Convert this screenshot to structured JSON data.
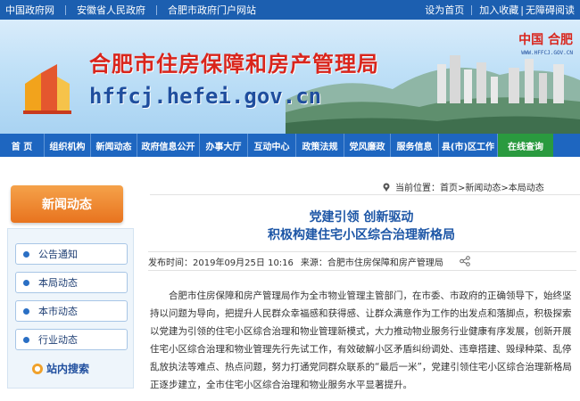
{
  "topbar": {
    "links": [
      "中国政府网",
      "安徽省人民政府",
      "合肥市政府门户网站"
    ],
    "right": [
      "设为首页",
      "加入收藏",
      "无障碍阅读"
    ]
  },
  "banner": {
    "title": "合肥市住房保障和房产管理局",
    "domain": "hffcj.hefei.gov.cn",
    "city_mark": "中国 合肥",
    "city_url": "WWW.HFFCJ.GOV.CN"
  },
  "nav": {
    "items": [
      "首 页",
      "组织机构",
      "新闻动态",
      "政府信息公开",
      "办事大厅",
      "互动中心",
      "政策法规",
      "党风廉政",
      "服务信息",
      "县(市)区工作",
      "在线查询"
    ]
  },
  "sidebar": {
    "header": "新闻动态",
    "items": [
      "公告通知",
      "本局动态",
      "本市动态",
      "行业动态"
    ],
    "search_label": "站内搜索"
  },
  "breadcrumb": {
    "prefix": "当前位置：",
    "path": "首页>新闻动态>本局动态"
  },
  "article": {
    "title_line1": "党建引领  创新驱动",
    "title_line2": "积极构建住宅小区综合治理新格局",
    "meta_label": "发布时间：",
    "meta_date": "2019年09月25日  10:16",
    "source_label": "来源：",
    "source": "合肥市住房保障和房产管理局",
    "body": "合肥市住房保障和房产管理局作为全市物业管理主管部门，在市委、市政府的正确领导下，始终坚持以问题为导向，把提升人民群众幸福感和获得感、让群众满意作为工作的出发点和落脚点，积极探索以党建为引领的住宅小区综合治理和物业管理新模式，大力推动物业服务行业健康有序发展，创新开展住宅小区综合治理和物业管理先行先试工作，有效破解小区矛盾纠纷调处、违章搭建、毁绿种菜、乱停乱放执法等难点、热点问题，努力打通党同群众联系的“最后一米”，党建引领住宅小区综合治理新格局正逐步建立，全市住宅小区综合治理和物业服务水平显著提升。"
  },
  "colors": {
    "topbar": "#1c5fb0",
    "nav": "#1e66c0",
    "nav_active": "#2a9a3f",
    "title_red": "#d9251c",
    "headline_blue": "#1d56a6",
    "sidebar_orange": "#e8731e"
  }
}
